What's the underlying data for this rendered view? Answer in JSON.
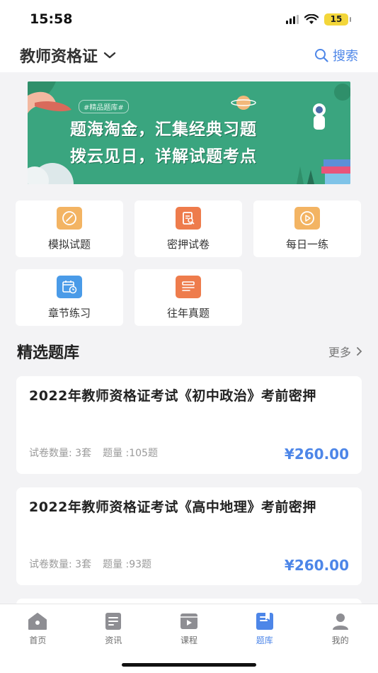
{
  "status": {
    "time": "15:58",
    "battery": "15"
  },
  "header": {
    "title": "教师资格证",
    "search_label": "搜索"
  },
  "banner": {
    "tag": "#精品题库#",
    "line1": "题海淘金，汇集经典习题",
    "line2": "拨云见日，详解试题考点"
  },
  "features": [
    {
      "label": "模拟试题",
      "icon": "pen-icon",
      "color": "#f3b463"
    },
    {
      "label": "密押试卷",
      "icon": "document-search-icon",
      "color": "#ee7c4c"
    },
    {
      "label": "每日一练",
      "icon": "play-icon",
      "color": "#f3b463"
    },
    {
      "label": "章节练习",
      "icon": "calendar-clock-icon",
      "color": "#4a9be8"
    },
    {
      "label": "往年真题",
      "icon": "list-icon",
      "color": "#ee7c4c"
    }
  ],
  "section": {
    "title": "精选题库",
    "more": "更多"
  },
  "cards": [
    {
      "title": "2022年教师资格证考试《初中政治》考前密押",
      "papers": "试卷数量: 3套",
      "questions": "题量 :105题",
      "price": "¥260.00"
    },
    {
      "title": "2022年教师资格证考试《高中地理》考前密押",
      "papers": "试卷数量: 3套",
      "questions": "题量 :93题",
      "price": "¥260.00"
    }
  ],
  "tabs": [
    {
      "label": "首页",
      "icon": "home-icon"
    },
    {
      "label": "资讯",
      "icon": "news-icon"
    },
    {
      "label": "课程",
      "icon": "video-icon"
    },
    {
      "label": "题库",
      "icon": "question-bank-icon",
      "active": true
    },
    {
      "label": "我的",
      "icon": "user-icon"
    }
  ],
  "colors": {
    "accent": "#4d86e8",
    "banner_bg": "#3aa57f"
  }
}
